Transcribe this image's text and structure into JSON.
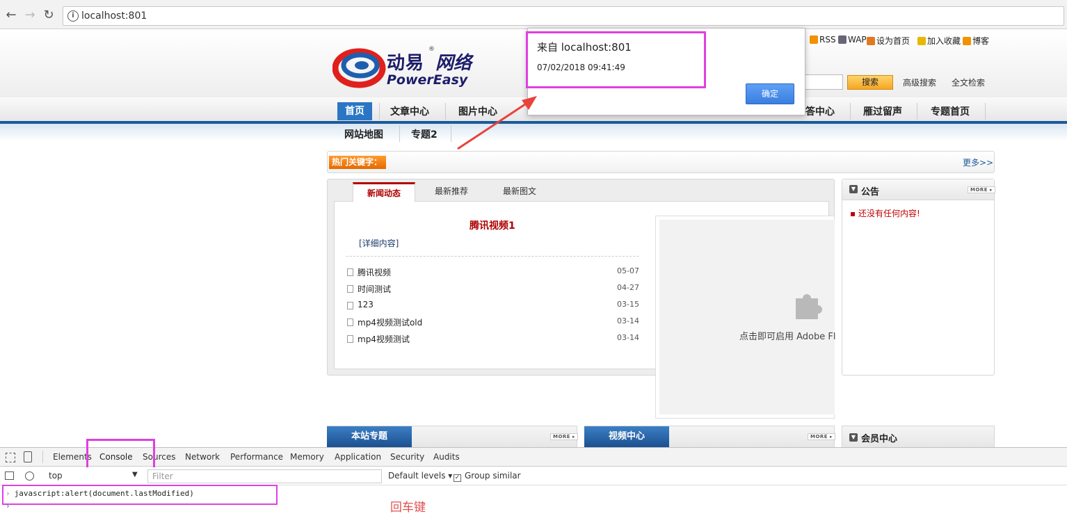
{
  "browser": {
    "url": "localhost:801",
    "back_icon": "←",
    "forward_icon": "→",
    "reload_icon": "↻",
    "info_icon": "i"
  },
  "site": {
    "logo_cn": "动易",
    "logo_cn2": "网络",
    "logo_en": "PowerEasy",
    "top_links": [
      "RSS",
      "WAP",
      "设为首页",
      "加入收藏",
      "博客"
    ],
    "search_button": "搜索",
    "advanced_search": "高级搜索",
    "fulltext_search": "全文检索",
    "nav_row1": [
      "首页",
      "文章中心",
      "图片中心",
      "答中心",
      "雁过留声",
      "专题首页"
    ],
    "nav_row2": [
      "网站地图",
      "专题2"
    ],
    "hot_keywords_label": "热门关键字：",
    "more_link": "更多>>",
    "news_tabs": [
      "新闻动态",
      "最新推荐",
      "最新图文"
    ],
    "headline": "腾讯视频1",
    "detail_link": "[详细内容]",
    "news_items": [
      {
        "title": "腾讯视频",
        "date": "05-07"
      },
      {
        "title": "时间测试",
        "date": "04-27"
      },
      {
        "title": "123",
        "date": "03-15"
      },
      {
        "title": "mp4视频测试old",
        "date": "03-14"
      },
      {
        "title": "mp4视频测试",
        "date": "03-14"
      }
    ],
    "flash_prompt": "点击即可启用 Adobe Fl",
    "notice_title": "公告",
    "notice_item": "还没有任何内容!",
    "more_badge": "MORE",
    "box_titles": [
      "本站专题",
      "视频中心",
      "会员中心"
    ]
  },
  "alert": {
    "title": "来自 localhost:801",
    "message": "07/02/2018 09:41:49",
    "ok_button": "确定"
  },
  "devtools": {
    "tabs": [
      "Elements",
      "Console",
      "Sources",
      "Network",
      "Performance",
      "Memory",
      "Application",
      "Security",
      "Audits"
    ],
    "context": "top",
    "filter_placeholder": "Filter",
    "levels": "Default levels",
    "group_similar": "Group similar",
    "command": "javascript:alert(document.lastModified)",
    "prompt_symbol": "›"
  },
  "annotation": {
    "enter_key_label": "回车键",
    "highlight_color": "#e040e0",
    "arrow_color": "#e8433a"
  },
  "colors": {
    "nav_active": "#2a76c4",
    "headline_red": "#b00000",
    "search_orange": "#f5a623",
    "alert_button": "#3a7fe0"
  }
}
